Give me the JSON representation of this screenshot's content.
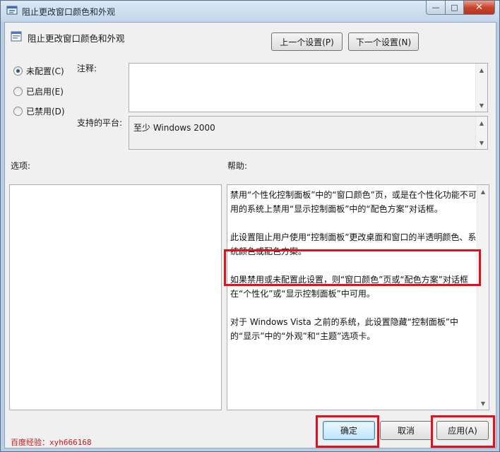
{
  "window": {
    "title": "阻止更改窗口颜色和外观",
    "caption": {
      "minimize": "—",
      "maximize": "□",
      "close": "✕"
    }
  },
  "header": {
    "policy_title": "阻止更改窗口颜色和外观",
    "prev_button": "上一个设置(P)",
    "next_button": "下一个设置(N)"
  },
  "state": {
    "options": [
      {
        "label": "未配置(C)",
        "selected": true
      },
      {
        "label": "已启用(E)",
        "selected": false
      },
      {
        "label": "已禁用(D)",
        "selected": false
      }
    ]
  },
  "comment": {
    "label": "注释:",
    "value": ""
  },
  "platform": {
    "label": "支持的平台:",
    "value": "至少 Windows 2000"
  },
  "options_panel": {
    "label": "选项:"
  },
  "help_panel": {
    "label": "帮助:",
    "paragraphs": [
      "禁用“个性化控制面板”中的“窗口颜色”页，或是在个性化功能不可用的系统上禁用“显示控制面板”中的“配色方案”对话框。",
      "此设置阻止用户使用“控制面板”更改桌面和窗口的半透明颜色、系统颜色或配色方案。",
      "如果禁用或未配置此设置，则“窗口颜色”页或“配色方案”对话框在“个性化”或“显示控制面板”中可用。",
      "对于 Windows Vista 之前的系统，此设置隐藏“控制面板”中的“显示”中的“外观”和“主题”选项卡。"
    ]
  },
  "footer": {
    "ok": "确定",
    "cancel": "取消",
    "apply": "应用(A)"
  },
  "watermark": "百度经验：xyh666168",
  "colors": {
    "highlight": "#e0101e",
    "watermark": "#d21414"
  }
}
